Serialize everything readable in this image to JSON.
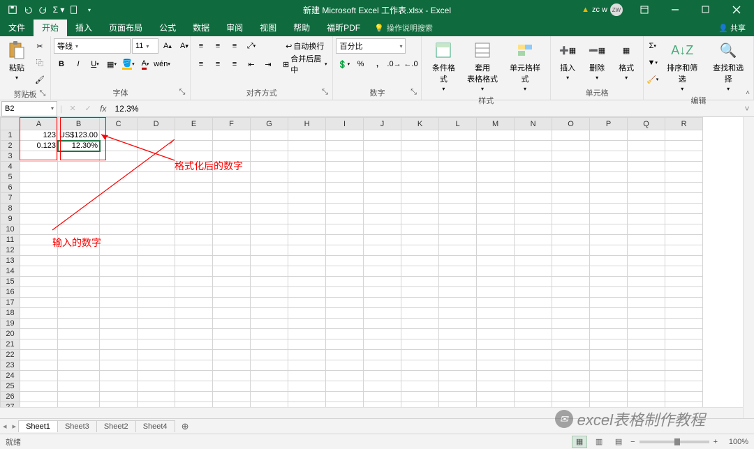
{
  "titlebar": {
    "title": "新建 Microsoft Excel 工作表.xlsx - Excel",
    "user": "zc w",
    "user_initials": "ZW"
  },
  "tabs": {
    "file": "文件",
    "home": "开始",
    "insert": "插入",
    "layout": "页面布局",
    "formulas": "公式",
    "data": "数据",
    "review": "审阅",
    "view": "视图",
    "help": "帮助",
    "foxit": "福昕PDF",
    "tellme": "操作说明搜索",
    "share": "共享"
  },
  "ribbon": {
    "clipboard": {
      "label": "剪贴板",
      "paste": "粘贴"
    },
    "font": {
      "label": "字体",
      "name": "等线",
      "size": "11"
    },
    "alignment": {
      "label": "对齐方式",
      "wrap": "自动换行",
      "merge": "合并后居中"
    },
    "number": {
      "label": "数字",
      "format": "百分比"
    },
    "styles": {
      "label": "样式",
      "cond": "条件格式",
      "table": "套用\n表格格式",
      "cell": "单元格样式"
    },
    "cells": {
      "label": "单元格",
      "insert": "插入",
      "delete": "删除",
      "format": "格式"
    },
    "editing": {
      "label": "编辑",
      "sort": "排序和筛选",
      "find": "查找和选择"
    }
  },
  "formula_bar": {
    "name": "B2",
    "value": "12.3%"
  },
  "columns": [
    "A",
    "B",
    "C",
    "D",
    "E",
    "F",
    "G",
    "H",
    "I",
    "J",
    "K",
    "L",
    "M",
    "N",
    "O",
    "P",
    "Q",
    "R"
  ],
  "rows": 27,
  "cells": {
    "A1": "123",
    "B1": "US$123.00",
    "A2": "0.123",
    "B2": "12.30%"
  },
  "selected": "B2",
  "sheets": [
    "Sheet1",
    "Sheet3",
    "Sheet2",
    "Sheet4"
  ],
  "active_sheet": "Sheet1",
  "status": {
    "ready": "就绪",
    "zoom": "100%"
  },
  "annotations": {
    "input_label": "输入的数字",
    "format_label": "格式化后的数字"
  },
  "watermark": "excel表格制作教程"
}
